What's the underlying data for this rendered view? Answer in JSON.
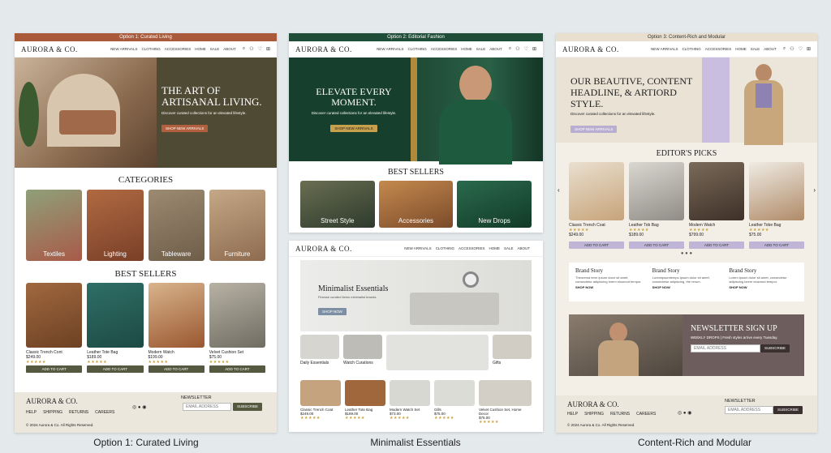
{
  "captions": [
    "Option 1: Curated Living",
    "Minimalist Essentials",
    "Content-Rich and Modular"
  ],
  "nav": {
    "logo": "AURORA & CO.",
    "items": [
      "NEW ARRIVALS",
      "CLOTHING",
      "ACCESSORIES",
      "HOME",
      "SALE",
      "ABOUT"
    ]
  },
  "p1": {
    "banner": "Option 1: Curated Living",
    "hero_title": "THE ART OF ARTISANAL LIVING.",
    "hero_sub": "Discover curated collections for an elevated lifestyle.",
    "hero_btn": "SHOP NEW ARRIVALS",
    "categories_title": "CATEGORIES",
    "categories": [
      "Textiles",
      "Lighting",
      "Tableware",
      "Furniture"
    ],
    "best_title": "BEST SELLERS",
    "products": [
      {
        "name": "Classic Trench Cont",
        "price": "$249.00"
      },
      {
        "name": "Leather Tote Bag",
        "price": "$189.00"
      },
      {
        "name": "Modern Watch",
        "price": "$199.00"
      },
      {
        "name": "Velvet Cushion Set",
        "price": "$75.00"
      }
    ],
    "add": "ADD TO CART",
    "footer_logo": "AURORA & CO.",
    "footer_links": [
      "HELP",
      "SHIPPING",
      "RETURNS",
      "CAREERS"
    ],
    "newsletter": "NEWSLETTER",
    "email_ph": "EMAIL ADDRESS",
    "subscribe": "SUBSCRIBE",
    "copyright": "© 2024 Aurora & Co. All Rights Reserved."
  },
  "p2": {
    "banner": "Option 2: Editorial Fashion",
    "hero_title": "ELEVATE EVERY MOMENT.",
    "hero_sub": "Discover curated collections for an elevated lifestyle.",
    "hero_btn": "SHOP NEW ARRIVALS",
    "best_title": "BEST SELLERS",
    "tiles": [
      "Street Style",
      "Accessories",
      "New Drops"
    ]
  },
  "p3": {
    "mini_title": "Minimalist Essentials",
    "mini_sub": "Finesse curated items minimalist brands.",
    "mini_btn": "SHOP NOW",
    "tiles": [
      "Daily Essentials",
      "Watch Curations",
      "Gifts"
    ],
    "products": [
      {
        "name": "Classic Trench Coat",
        "price": "$249.00"
      },
      {
        "name": "Leather Tote Bag",
        "price": "$189.00"
      },
      {
        "name": "Modern Watch Set",
        "price": "$73.00"
      },
      {
        "name": "Gills",
        "price": "$75.00"
      },
      {
        "name": "Velvet Cushion Set, Home Decor",
        "price": "$75.00"
      }
    ]
  },
  "p4": {
    "banner": "Option 3: Content-Rich and Modular",
    "hero_title": "OUR BEAUTIVE, CONTENT HEADLINE, & ARTIORD STYLE.",
    "hero_sub": "Discover curated collections for an elevated lifestyle.",
    "hero_btn": "SHOP NEW ARRIVALS",
    "picks_title": "EDITOR'S PICKS",
    "products": [
      {
        "name": "Classic Trench Coat",
        "price": "$249.00"
      },
      {
        "name": "Leather Tob Bag",
        "price": "$189.00"
      },
      {
        "name": "Modern Watch",
        "price": "$799.00"
      },
      {
        "name": "Leather Tobe Bag",
        "price": "$75.00"
      }
    ],
    "add": "ADD TO CART",
    "stories": [
      {
        "title": "Brand Story",
        "text": "Theorema term ipsum dolor sit amet, consectetur adipiscing lorem eiusmod tempor.",
        "link": "SHOP NOW"
      },
      {
        "title": "Brand Story",
        "text": "Loremipsumtempo ipsum dolor sit amet, consectetur adipiscing, the rerum.",
        "link": "SHOP NOW"
      },
      {
        "title": "Brand Story",
        "text": "Lorem ipsum dolor sit amet, consectetur adipiscing lorem eiusmod tempor.",
        "link": "SHOP NOW"
      }
    ],
    "news_title": "NEWSLETTER SIGN UP",
    "news_sub": "WEEKLY DROPS | Fresh styles arrive every Tuesday.",
    "email_ph": "EMAIL ADDRESS",
    "subscribe": "SUBSCRIBE",
    "footer_logo": "AURORA & CO.",
    "footer_links": [
      "HELP",
      "SHIPPING",
      "RETURNS",
      "CAREERS"
    ],
    "newsletter": "NEWSLETTER",
    "copyright": "© 2024 Aurora & Co. All Rights Reserved."
  },
  "colors": {
    "p1_banner": "#a85a3a",
    "p1_hero": "#4f4a33",
    "p2_banner": "#1f4d38",
    "p2_hero": "#173f2d",
    "p4_banner": "#e8dfcf",
    "lilac": "#b9aed2"
  }
}
